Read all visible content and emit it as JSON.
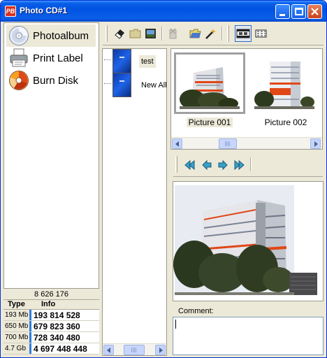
{
  "window": {
    "title": "Photo CD#1",
    "app_icon_text": "PB"
  },
  "nav": {
    "items": [
      {
        "label": "Photoalbum",
        "icon": "cd-disc-icon",
        "selected": true
      },
      {
        "label": "Print Label",
        "icon": "printer-icon",
        "selected": false
      },
      {
        "label": "Burn Disk",
        "icon": "burn-disc-icon",
        "selected": false
      }
    ]
  },
  "stats": {
    "total": "8 626 176",
    "header": {
      "type": "Type",
      "info": "Info"
    },
    "rows": [
      {
        "type": "193 Mb",
        "info": "193 814 528"
      },
      {
        "type": "650 Mb",
        "info": "679 823 360"
      },
      {
        "type": "700 Mb",
        "info": "728 340 480"
      },
      {
        "type": "4.7 Gb",
        "info": "4 697 448 448"
      }
    ]
  },
  "tree": {
    "items": [
      {
        "label": "test",
        "selected": true
      },
      {
        "label": "New Alb",
        "selected": false
      }
    ]
  },
  "thumbnails": [
    {
      "caption": "Picture 001",
      "selected": true
    },
    {
      "caption": "Picture 002",
      "selected": false
    }
  ],
  "comment": {
    "label": "Comment:",
    "value": ""
  },
  "colors": {
    "titlebar": "#0053e1",
    "facade_accent": "#e04818",
    "selection": "#ece9d8"
  }
}
